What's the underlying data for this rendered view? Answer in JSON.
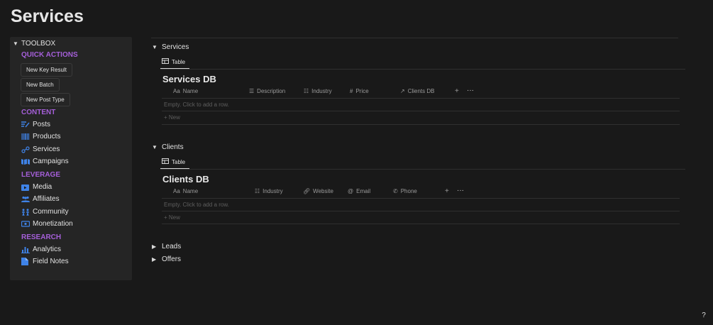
{
  "page": {
    "title": "Services"
  },
  "toolbox": {
    "title": "TOOLBOX",
    "quick_actions": {
      "heading": "QUICK ACTIONS",
      "buttons": [
        "New Key Result",
        "New Batch",
        "New Post Type"
      ]
    },
    "content": {
      "heading": "CONTENT",
      "items": [
        "Posts",
        "Products",
        "Services",
        "Campaigns"
      ]
    },
    "leverage": {
      "heading": "LEVERAGE",
      "items": [
        "Media",
        "Affiliates",
        "Community",
        "Monetization"
      ]
    },
    "research": {
      "heading": "RESEARCH",
      "items": [
        "Analytics",
        "Field Notes"
      ]
    },
    "colors": {
      "section_heading": "#a55fd9",
      "icon": "#3f83e8"
    }
  },
  "sections": {
    "services": {
      "toggle": "Services",
      "view_tab": "Table",
      "db_title": "Services DB",
      "columns": [
        "Name",
        "Description",
        "Industry",
        "Price",
        "Clients DB"
      ],
      "name_prefix": "Aa",
      "empty_text": "Empty. Click to add a row.",
      "new_label": "New"
    },
    "clients": {
      "toggle": "Clients",
      "view_tab": "Table",
      "db_title": "Clients DB",
      "columns": [
        "Name",
        "Industry",
        "Website",
        "Email",
        "Phone"
      ],
      "name_prefix": "Aa",
      "empty_text": "Empty. Click to add a row.",
      "new_label": "New"
    },
    "leads": {
      "toggle": "Leads"
    },
    "offers": {
      "toggle": "Offers"
    }
  },
  "icons": {
    "table_view": "table-icon",
    "add_column": "plus-icon",
    "more": "ellipsis-icon",
    "help": "help-icon"
  },
  "help": {
    "label": "?"
  }
}
